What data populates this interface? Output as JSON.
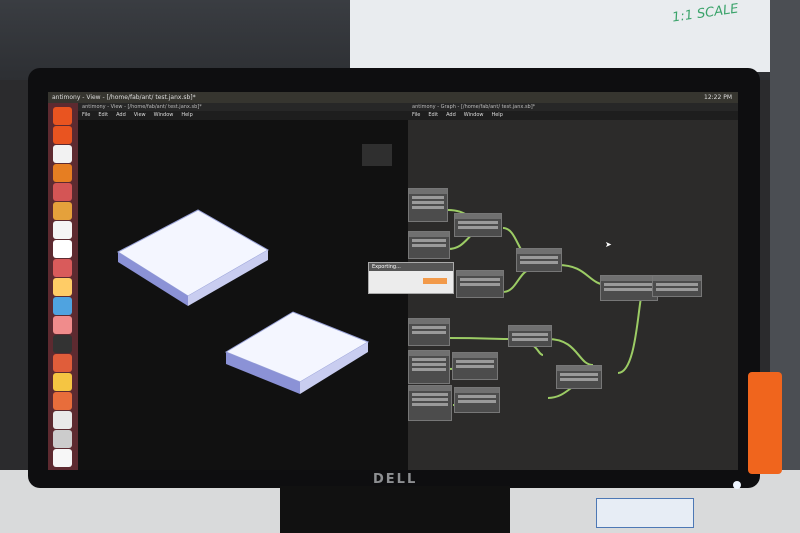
{
  "window": {
    "view_title": "antimony - View - [/home/fab/ant/ test.janx.sb]*",
    "graph_title": "antimony - Graph - [/home/fab/ant/ test.janx.sb]*",
    "topbar_title": "antimony - View - [/home/fab/ant/ test.janx.sb]*",
    "clock": "12:22 PM"
  },
  "menus": [
    "File",
    "Edit",
    "Add",
    "View",
    "Window",
    "Help"
  ],
  "graph_menus": [
    "File",
    "Edit",
    "Add",
    "Window",
    "Help"
  ],
  "dialog": {
    "title": "Exporting..."
  },
  "background": {
    "whiteboard_text": "1:1 SCALE"
  },
  "monitor": {
    "brand": "DELL"
  },
  "launcher_colors": [
    "#e95420",
    "#e95420",
    "#f2f2f2",
    "#e67e22",
    "#d45555",
    "#e5a13b",
    "#f5f5f5",
    "#ffffff",
    "#d95b5b",
    "#ffcc66",
    "#4fa3e0",
    "#f08c8c",
    "#333333",
    "#e05d3a",
    "#f5c542",
    "#e86d3b",
    "#e9e9e9",
    "#cccccc",
    "#f7f7f7"
  ]
}
